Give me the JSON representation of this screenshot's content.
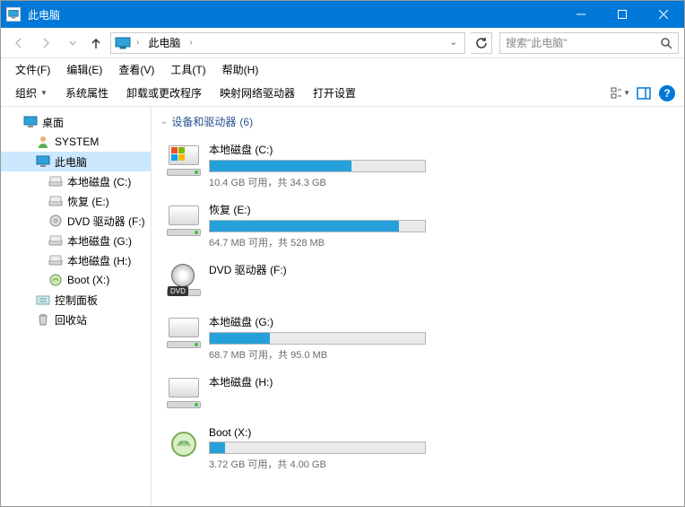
{
  "title": "此电脑",
  "breadcrumb": {
    "root": "此电脑"
  },
  "search": {
    "placeholder": "搜索\"此电脑\""
  },
  "menu": {
    "file": "文件(F)",
    "edit": "编辑(E)",
    "view": "查看(V)",
    "tools": "工具(T)",
    "help": "帮助(H)"
  },
  "toolbar": {
    "organize": "组织",
    "sysprops": "系统属性",
    "uninstall": "卸载或更改程序",
    "mapdrive": "映射网络驱动器",
    "opensettings": "打开设置"
  },
  "section": {
    "header": "设备和驱动器",
    "count": "(6)"
  },
  "tree": [
    {
      "label": "桌面",
      "icon": "desktop",
      "depth": 0
    },
    {
      "label": "SYSTEM",
      "icon": "user",
      "depth": 1
    },
    {
      "label": "此电脑",
      "icon": "pc",
      "depth": 1,
      "selected": true
    },
    {
      "label": "本地磁盘 (C:)",
      "icon": "hdd",
      "depth": 2
    },
    {
      "label": "恢复 (E:)",
      "icon": "hdd",
      "depth": 2
    },
    {
      "label": "DVD 驱动器 (F:)",
      "icon": "dvd",
      "depth": 2
    },
    {
      "label": "本地磁盘 (G:)",
      "icon": "hdd",
      "depth": 2
    },
    {
      "label": "本地磁盘 (H:)",
      "icon": "hdd",
      "depth": 2
    },
    {
      "label": "Boot (X:)",
      "icon": "boot",
      "depth": 2
    },
    {
      "label": "控制面板",
      "icon": "cpl",
      "depth": 1
    },
    {
      "label": "回收站",
      "icon": "bin",
      "depth": 1
    }
  ],
  "drives": [
    {
      "name": "本地磁盘 (C:)",
      "free": "10.4 GB 可用，共 34.3 GB",
      "fill": 66,
      "icon": "win",
      "col": 0
    },
    {
      "name": "恢复 (E:)",
      "free": "64.7 MB 可用，共 528 MB",
      "fill": 88,
      "icon": "hdd",
      "col": 1
    },
    {
      "name": "DVD 驱动器 (F:)",
      "free": "",
      "fill": -1,
      "icon": "dvd",
      "col": 0
    },
    {
      "name": "本地磁盘 (G:)",
      "free": "68.7 MB 可用，共 95.0 MB",
      "fill": 28,
      "icon": "hdd",
      "col": 1
    },
    {
      "name": "本地磁盘 (H:)",
      "free": "",
      "fill": -1,
      "icon": "hdd",
      "col": 0
    },
    {
      "name": "Boot (X:)",
      "free": "3.72 GB 可用，共 4.00 GB",
      "fill": 7,
      "icon": "boot",
      "col": 1
    }
  ]
}
